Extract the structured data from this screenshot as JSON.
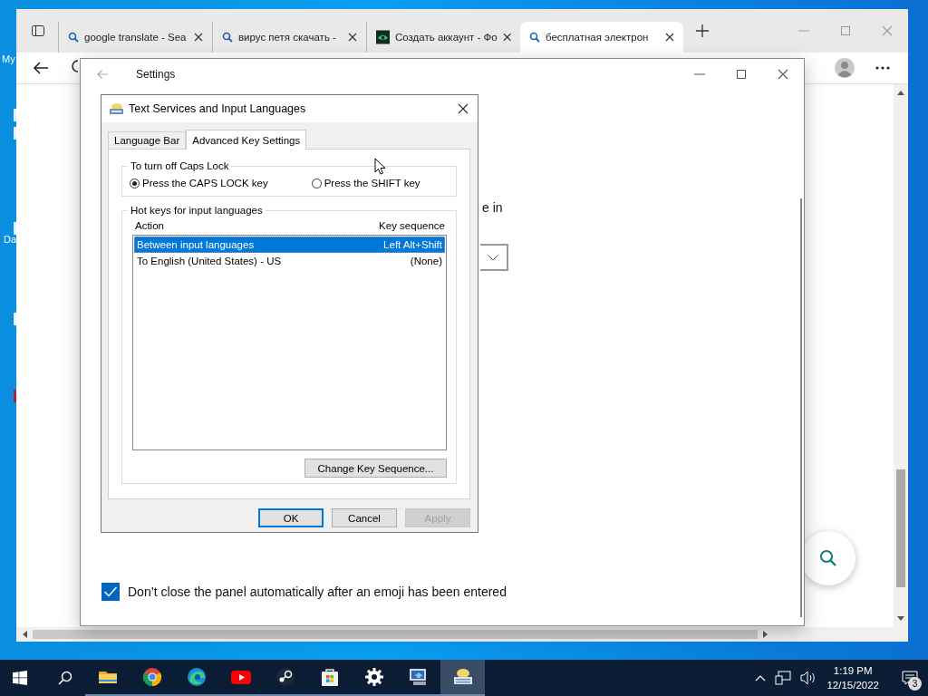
{
  "desktop": {
    "icon_labels": [
      "My",
      "Da"
    ]
  },
  "browser": {
    "tabs": [
      {
        "title": "google translate - Sea",
        "kind": "search",
        "selected": false
      },
      {
        "title": "вирус петя скачать -",
        "kind": "search",
        "selected": false
      },
      {
        "title": "Создать аккаунт - Фо",
        "kind": "app",
        "selected": false
      },
      {
        "title": "бесплатная электрон",
        "kind": "search",
        "selected": true
      }
    ]
  },
  "settings": {
    "title": "Settings",
    "partial_text": "e in",
    "checkbox": {
      "label": "Don’t close the panel automatically after an emoji has been entered",
      "checked": true
    }
  },
  "dialog": {
    "title": "Text Services and Input Languages",
    "tabs": [
      {
        "label": "Language Bar",
        "selected": false
      },
      {
        "label": "Advanced Key Settings",
        "selected": true
      }
    ],
    "caps_group": {
      "title": "To turn off Caps Lock",
      "options": [
        {
          "label": "Press the CAPS LOCK key",
          "selected": true
        },
        {
          "label": "Press the SHIFT key",
          "selected": false
        }
      ]
    },
    "hotkeys": {
      "title": "Hot keys for input languages",
      "columns": [
        "Action",
        "Key sequence"
      ],
      "rows": [
        {
          "action": "Between input languages",
          "sequence": "Left Alt+Shift",
          "selected": true
        },
        {
          "action": "To English (United States) - US",
          "sequence": "(None)",
          "selected": false
        }
      ]
    },
    "change_button": "Change Key Sequence...",
    "buttons": [
      {
        "label": "OK",
        "default": true,
        "disabled": false
      },
      {
        "label": "Cancel",
        "default": false,
        "disabled": false
      },
      {
        "label": "Apply",
        "default": false,
        "disabled": true
      }
    ]
  },
  "taskbar": {
    "apps": [
      {
        "kind": "folder",
        "active": false
      },
      {
        "kind": "chrome",
        "active": false
      },
      {
        "kind": "edge",
        "active": false
      },
      {
        "kind": "youtube",
        "active": false
      },
      {
        "kind": "steam",
        "active": false
      },
      {
        "kind": "store",
        "active": false
      },
      {
        "kind": "gear",
        "active": false
      },
      {
        "kind": "computer",
        "active": false
      },
      {
        "kind": "keyboard",
        "active": true
      }
    ],
    "time": "1:19 PM",
    "date": "12/15/2022",
    "notifications": "3"
  }
}
